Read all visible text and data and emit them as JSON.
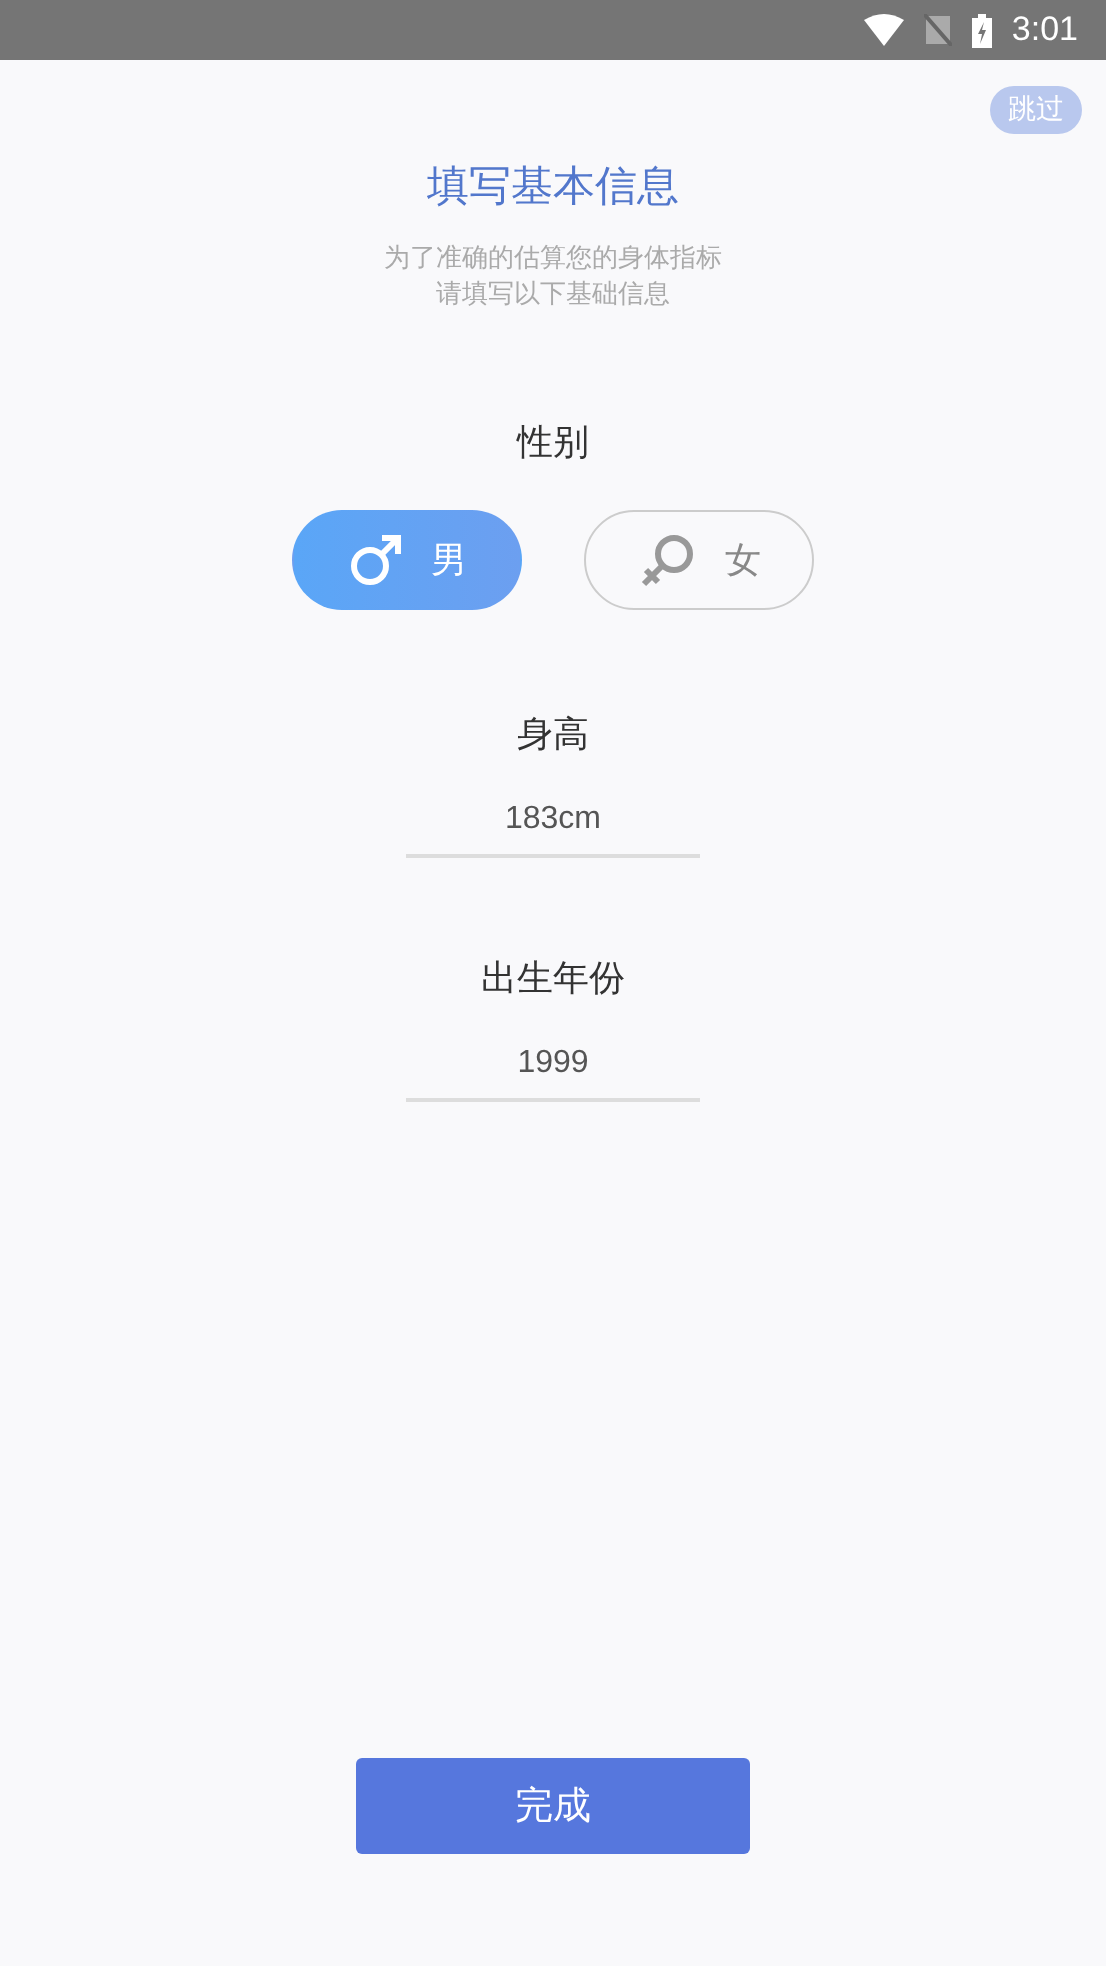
{
  "status_bar": {
    "time": "3:01"
  },
  "skip_button": "跳过",
  "title": "填写基本信息",
  "subtitle_lines": [
    "为了准确的估算您的身体指标",
    "请填写以下基础信息"
  ],
  "gender": {
    "label": "性别",
    "options": [
      {
        "kind": "male",
        "label": "男",
        "selected": true
      },
      {
        "kind": "female",
        "label": "女",
        "selected": false
      }
    ]
  },
  "fields": [
    {
      "label": "身高",
      "value": "183cm"
    },
    {
      "label": "出生年份",
      "value": "1999"
    }
  ],
  "submit_button": "完成"
}
